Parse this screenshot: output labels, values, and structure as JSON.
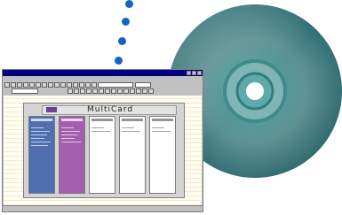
{
  "colors": {
    "dot": "#1565c0",
    "cd_body": "#2f8a8a",
    "window_titlebar": "#000080",
    "card_blue": "#4f6fb0",
    "card_purple": "#a35fad",
    "card_white": "#ffffff"
  },
  "icons": [
    "dots-decoration",
    "cd-disc-icon",
    "app-window-screenshot",
    "app-logo-icon"
  ],
  "app_window": {
    "title_text": "",
    "menu_items": [
      "",
      "",
      "",
      "",
      ""
    ],
    "header_title": "MultiCard",
    "status_text": ""
  },
  "cards": [
    {
      "name": "card-1",
      "color": "#4f6fb0",
      "lines": 6
    },
    {
      "name": "card-2",
      "color": "#a35fad",
      "lines": 5
    },
    {
      "name": "card-3",
      "color": "#ffffff",
      "lines": 2
    },
    {
      "name": "card-4",
      "color": "#ffffff",
      "lines": 2
    },
    {
      "name": "card-5",
      "color": "#ffffff",
      "lines": 2
    }
  ]
}
